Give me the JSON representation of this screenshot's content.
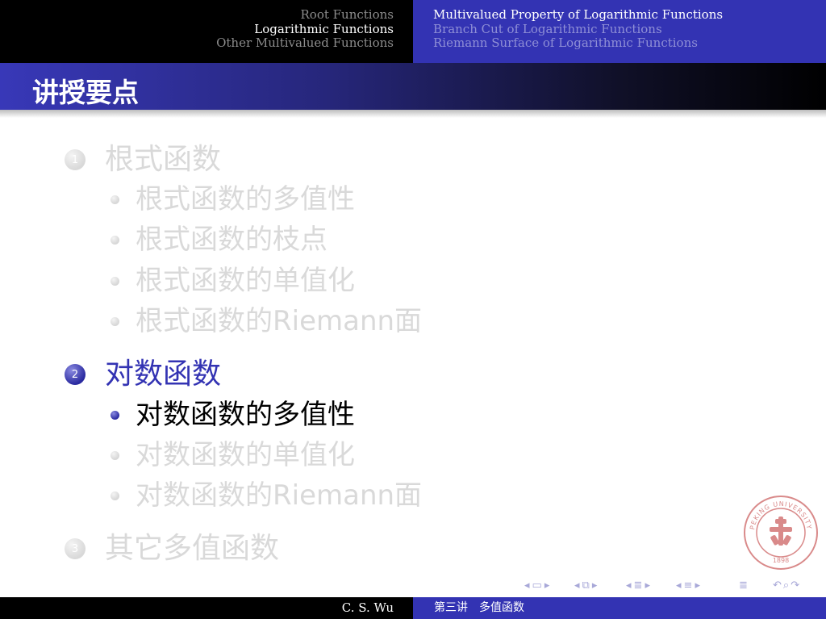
{
  "header": {
    "left_items": [
      "Root Functions",
      "Logarithmic Functions",
      "Other Multivalued Functions"
    ],
    "right_items": [
      "Multivalued Property of Logarithmic Functions",
      "Branch Cut of Logarithmic Functions",
      "Riemann Surface of Logarithmic Functions"
    ]
  },
  "frame": {
    "title": "讲授要点"
  },
  "outline": {
    "sections": [
      {
        "number": "1",
        "label": "根式函数",
        "items": [
          "根式函数的多值性",
          "根式函数的枝点",
          "根式函数的单值化",
          "根式函数的Riemann面"
        ]
      },
      {
        "number": "2",
        "label": "对数函数",
        "items": [
          "对数函数的多值性",
          "对数函数的单值化",
          "对数函数的Riemann面"
        ]
      },
      {
        "number": "3",
        "label": "其它多值函数",
        "items": []
      }
    ]
  },
  "logo": {
    "text": "PEKING UNIVERSITY",
    "year": "1898"
  },
  "footer": {
    "author": "C. S. Wu",
    "lecture": "第三讲　多值函数"
  },
  "colors": {
    "accent": "#3333b3",
    "dim_text": "#d9d9d9",
    "header_black": "#000000"
  }
}
